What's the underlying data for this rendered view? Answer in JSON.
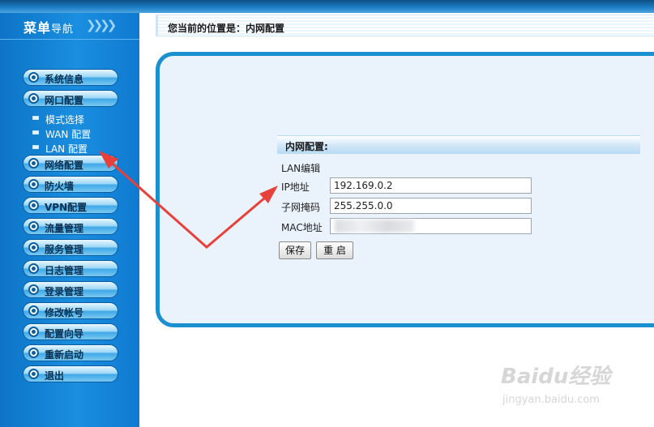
{
  "sidebar": {
    "title_main": "菜单",
    "title_small": "导航",
    "chevrons": "❯❯❯❯",
    "menu": [
      {
        "label": "系统信息"
      },
      {
        "label": "网口配置"
      },
      {
        "label": "网络配置"
      },
      {
        "label": "防火墙"
      },
      {
        "label": "VPN配置"
      },
      {
        "label": "流量管理"
      },
      {
        "label": "服务管理"
      },
      {
        "label": "日志管理"
      },
      {
        "label": "登录管理"
      },
      {
        "label": "修改帐号"
      },
      {
        "label": "配置向导"
      },
      {
        "label": "重新启动"
      },
      {
        "label": "退出"
      }
    ],
    "submenu": [
      {
        "label": "模式选择"
      },
      {
        "label": "WAN 配置"
      },
      {
        "label": "LAN 配置"
      }
    ]
  },
  "breadcrumb": {
    "text": "您当前的位置是：内网配置"
  },
  "form": {
    "section_title": "内网配置:",
    "group_label": "LAN编辑",
    "ip_label": "IP地址",
    "ip_value": "192.169.0.2",
    "mask_label": "子网掩码",
    "mask_value": "255.255.0.0",
    "mac_label": "MAC地址",
    "save_label": "保存",
    "restart_label": "重 启"
  },
  "watermark": {
    "brand": "Baidu经验",
    "url": "jingyan.baidu.com"
  },
  "colors": {
    "sidebar_bg": "#1a8ee0",
    "panel_border": "#1a90cf",
    "arrow": "#e8403a"
  }
}
